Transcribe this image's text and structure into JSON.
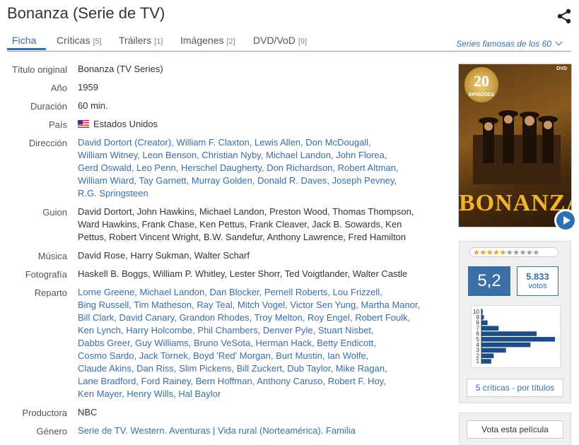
{
  "title": "Bonanza (Serie de TV)",
  "tabs": [
    {
      "label": "Ficha",
      "count": ""
    },
    {
      "label": "Críticas",
      "count": "[5]"
    },
    {
      "label": "Tráilers",
      "count": "[1]"
    },
    {
      "label": "Imágenes",
      "count": "[2]"
    },
    {
      "label": "DVD/VoD",
      "count": "[9]"
    }
  ],
  "series_link": "Series famosas de los 60",
  "details": {
    "titulo_original": {
      "label": "Título original",
      "value": "Bonanza (TV Series)"
    },
    "anio": {
      "label": "Año",
      "value": "1959"
    },
    "duracion": {
      "label": "Duración",
      "value": "60 min."
    },
    "pais": {
      "label": "País",
      "value": "Estados Unidos"
    },
    "direccion": {
      "label": "Dirección",
      "lines": [
        [
          "David Dortort (Creator),",
          "William F. Claxton,",
          "Lewis Allen,",
          "Don McDougall,"
        ],
        [
          "William Witney,",
          "Leon Benson,",
          "Christian Nyby,",
          "Michael Landon,",
          "John Florea,"
        ],
        [
          "Gerd Oswald,",
          "Leo Penn,",
          "Herschel Daugherty,",
          "Don Richardson,",
          "Robert Altman,"
        ],
        [
          "William Wiard,",
          "Tay Garnett,",
          "Murray Golden,",
          "Donald R. Daves,",
          "Joseph Pevney,"
        ],
        [
          "R.G. Springsteen"
        ]
      ]
    },
    "guion": {
      "label": "Guion",
      "lines": [
        "David Dortort, John Hawkins, Michael Landon, Preston Wood, Thomas Thompson,",
        "Ward Hawkins, Frank Chase, Ken Pettus, Frank Cleaver, Jack B. Sowards, Ken",
        "Pettus, Robert Vincent Wright, B.W. Sandefur, Anthony Lawrence, Fred Hamilton"
      ]
    },
    "musica": {
      "label": "Música",
      "value": "David Rose, Harry Sukman, Walter Scharf"
    },
    "fotografia": {
      "label": "Fotografía",
      "value": "Haskell B. Boggs, William P. Whitley, Lester Shorr, Ted Voigtlander, Walter Castle"
    },
    "reparto": {
      "label": "Reparto",
      "lines": [
        [
          "Lorne Greene,",
          "Michael Landon,",
          "Dan Blocker,",
          "Pernell Roberts,",
          "Lou Frizzell,"
        ],
        [
          "Bing Russell,",
          "Tim Matheson,",
          "Ray Teal,",
          "Mitch Vogel,",
          "Victor Sen Yung,",
          "Martha Manor,"
        ],
        [
          "Bill Clark,",
          "David Canary,",
          "Grandon Rhodes,",
          "Troy Melton,",
          "Roy Engel,",
          "Robert Foulk,"
        ],
        [
          "Ken Lynch,",
          "Harry Holcombe,",
          "Phil Chambers,",
          "Denver Pyle,",
          "Stuart Nisbet,"
        ],
        [
          "Dabbs Greer,",
          "Guy Williams,",
          "Bruno VeSota,",
          "Herman Hack,",
          "Betty Endicott,"
        ],
        [
          "Cosmo Sardo,",
          "Jack Tornek,",
          "Boyd 'Red' Morgan,",
          "Burt Mustin,",
          "Ian Wolfe,"
        ],
        [
          "Claude Akins,",
          "Dan Riss,",
          "Slim Pickens,",
          "Bill Zuckert,",
          "Dub Taylor,",
          "Mike Ragan,"
        ],
        [
          "Lane Bradford,",
          "Ford Rainey,",
          "Bern Hoffman,",
          "Anthony Caruso,",
          "Robert F. Hoy,"
        ],
        [
          "Ken Mayer,",
          "Henry Wills,",
          "Hal Baylor"
        ]
      ]
    },
    "productora": {
      "label": "Productora",
      "value": "NBC"
    },
    "genero": {
      "label": "Género",
      "value": "Serie de TV. Western. Aventuras | Vida rural (Norteamérica). Familia"
    }
  },
  "poster": {
    "badge": "20",
    "badge_sub": "EPISODES",
    "dvd": "DVD",
    "title": "BONANZA"
  },
  "rating": {
    "stars_on": 5,
    "stars_total": 10,
    "average": "5,2",
    "votes_count": "5.833",
    "votes_label": "votos",
    "histogram": {
      "labels": [
        "10",
        "9",
        "8",
        "7",
        "6",
        "5",
        "4",
        "3",
        "2",
        "1"
      ],
      "values": [
        1,
        2,
        5,
        14,
        45,
        60,
        40,
        20,
        10,
        8
      ]
    },
    "criticas_link": "5 críticas - por títulos",
    "vote_button": "Vota esta película"
  }
}
